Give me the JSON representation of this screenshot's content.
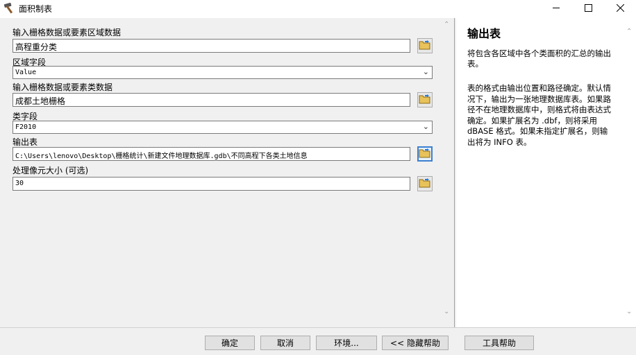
{
  "window": {
    "title": "面积制表"
  },
  "form": {
    "zone_raster_label": "输入栅格数据或要素区域数据",
    "zone_raster_value": "高程重分类",
    "zone_field_label": "区域字段",
    "zone_field_value": "Value",
    "class_raster_label": "输入栅格数据或要素类数据",
    "class_raster_value": "成都土地栅格",
    "class_field_label": "类字段",
    "class_field_value": "F2010",
    "output_table_label": "输出表",
    "output_table_value": "C:\\Users\\lenovo\\Desktop\\栅格统计\\新建文件地理数据库.gdb\\不同高程下各类土地信息",
    "cell_size_label": "处理像元大小 (可选)",
    "cell_size_value": "30"
  },
  "help": {
    "title": "输出表",
    "p1": "将包含各区域中各个类面积的汇总的输出表。",
    "p2": "表的格式由输出位置和路径确定。默认情况下，输出为一张地理数据库表。如果路径不在地理数据库中，则格式将由表达式确定。如果扩展名为 .dbf，则将采用 dBASE 格式。如果未指定扩展名，则输出将为 INFO 表。"
  },
  "buttons": {
    "ok": "确定",
    "cancel": "取消",
    "environments": "环境...",
    "hide_help": "<< 隐藏帮助",
    "tool_help": "工具帮助"
  },
  "icons": {
    "title": "hammer-icon",
    "browse": "open-folder-icon"
  }
}
